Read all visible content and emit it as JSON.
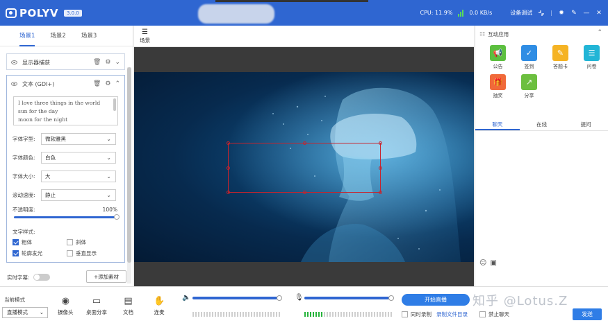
{
  "titlebar": {
    "logo": "POLYV",
    "version": "3.0.0",
    "cpu_label": "CPU:",
    "cpu_value": "11.9%",
    "net": "0.0 KB/s",
    "settings": "设备调试"
  },
  "left": {
    "tabs": [
      "场景1",
      "场景2",
      "场景3"
    ],
    "sources": [
      {
        "name": "显示器捕获"
      },
      {
        "name": "文本 (GDI+)"
      }
    ],
    "text_content": [
      "I love three things in the world",
      "sun for the day",
      "moon for the night"
    ],
    "font_label": "字体字型:",
    "font_value": "微软雅黑",
    "color_label": "字体颜色:",
    "color_value": "白色",
    "size_label": "字体大小:",
    "size_value": "大",
    "scroll_label": "滚动速度:",
    "scroll_value": "静止",
    "opacity_label": "不透明度:",
    "opacity_value": "100%",
    "opacity_level": 1.0,
    "style_label": "文字样式:",
    "styles": [
      {
        "label": "粗体",
        "checked": true
      },
      {
        "label": "斜体",
        "checked": false
      },
      {
        "label": "轮廓发光",
        "checked": true
      },
      {
        "label": "垂直显示",
        "checked": false
      }
    ],
    "subtitle_label": "实时字幕:",
    "add_button": "+添加素材"
  },
  "center": {
    "scene_button": "场景"
  },
  "right": {
    "title": "互动应用",
    "apps": [
      {
        "label": "公告",
        "color": "#5cbf3f",
        "icon": "megaphone-icon"
      },
      {
        "label": "签到",
        "color": "#2f8de4",
        "icon": "calendar-check-icon"
      },
      {
        "label": "答题卡",
        "color": "#f5b324",
        "icon": "answer-card-icon"
      },
      {
        "label": "问卷",
        "color": "#22b5d6",
        "icon": "survey-icon"
      },
      {
        "label": "抽奖",
        "color": "#f06a3a",
        "icon": "lottery-icon"
      },
      {
        "label": "分享",
        "color": "#6cbf3f",
        "icon": "share-icon"
      }
    ],
    "chat_tabs": [
      "聊天",
      "在线",
      "提问"
    ]
  },
  "bottom": {
    "mode_label": "当前模式",
    "mode_value": "直播模式",
    "tools": [
      "摄像头",
      "桌面分享",
      "文档",
      "连麦"
    ],
    "start_button": "开始直播",
    "record_label": "同时录制",
    "record_link": "录制文件目录",
    "ban_chat": "禁止聊天",
    "send": "发送",
    "watermark": "知乎 @Lotus.Z"
  },
  "colors": {
    "brand": "#2f66d1",
    "button": "#2f7de6"
  }
}
